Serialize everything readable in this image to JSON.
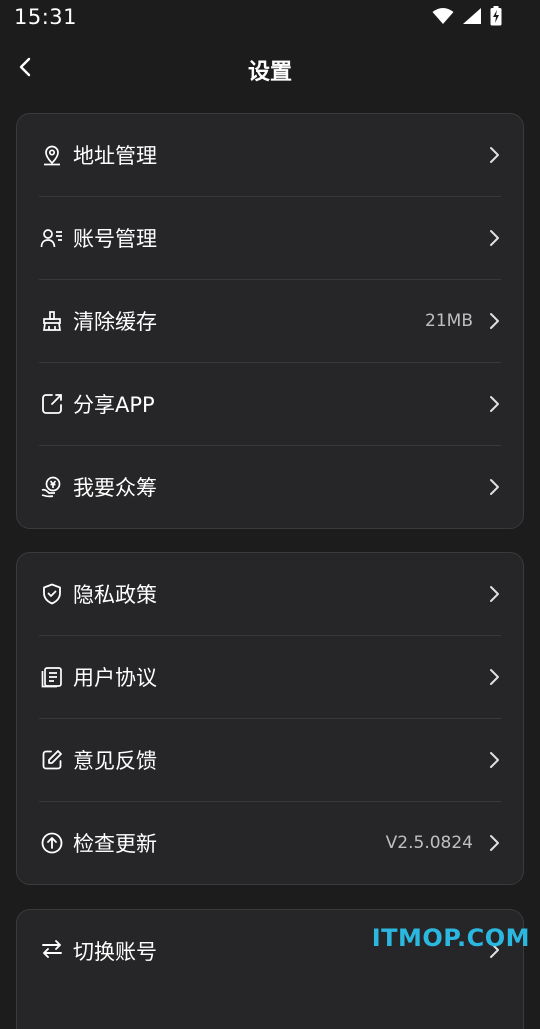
{
  "status_bar": {
    "time": "15:31"
  },
  "header": {
    "title": "设置"
  },
  "groups": [
    {
      "items": [
        {
          "label": "地址管理",
          "value": ""
        },
        {
          "label": "账号管理",
          "value": ""
        },
        {
          "label": "清除缓存",
          "value": "21MB"
        },
        {
          "label": "分享APP",
          "value": ""
        },
        {
          "label": "我要众筹",
          "value": ""
        }
      ]
    },
    {
      "items": [
        {
          "label": "隐私政策",
          "value": ""
        },
        {
          "label": "用户协议",
          "value": ""
        },
        {
          "label": "意见反馈",
          "value": ""
        },
        {
          "label": "检查更新",
          "value": "V2.5.0824"
        }
      ]
    },
    {
      "items": [
        {
          "label": "切换账号",
          "value": ""
        }
      ]
    }
  ],
  "watermark": "ITMOP.COM",
  "icons": [
    "location-pin-icon",
    "user-list-icon",
    "broom-icon",
    "share-icon",
    "donate-icon",
    "shield-check-icon",
    "document-icon",
    "edit-icon",
    "upload-arrow-icon",
    "switch-arrows-icon"
  ]
}
